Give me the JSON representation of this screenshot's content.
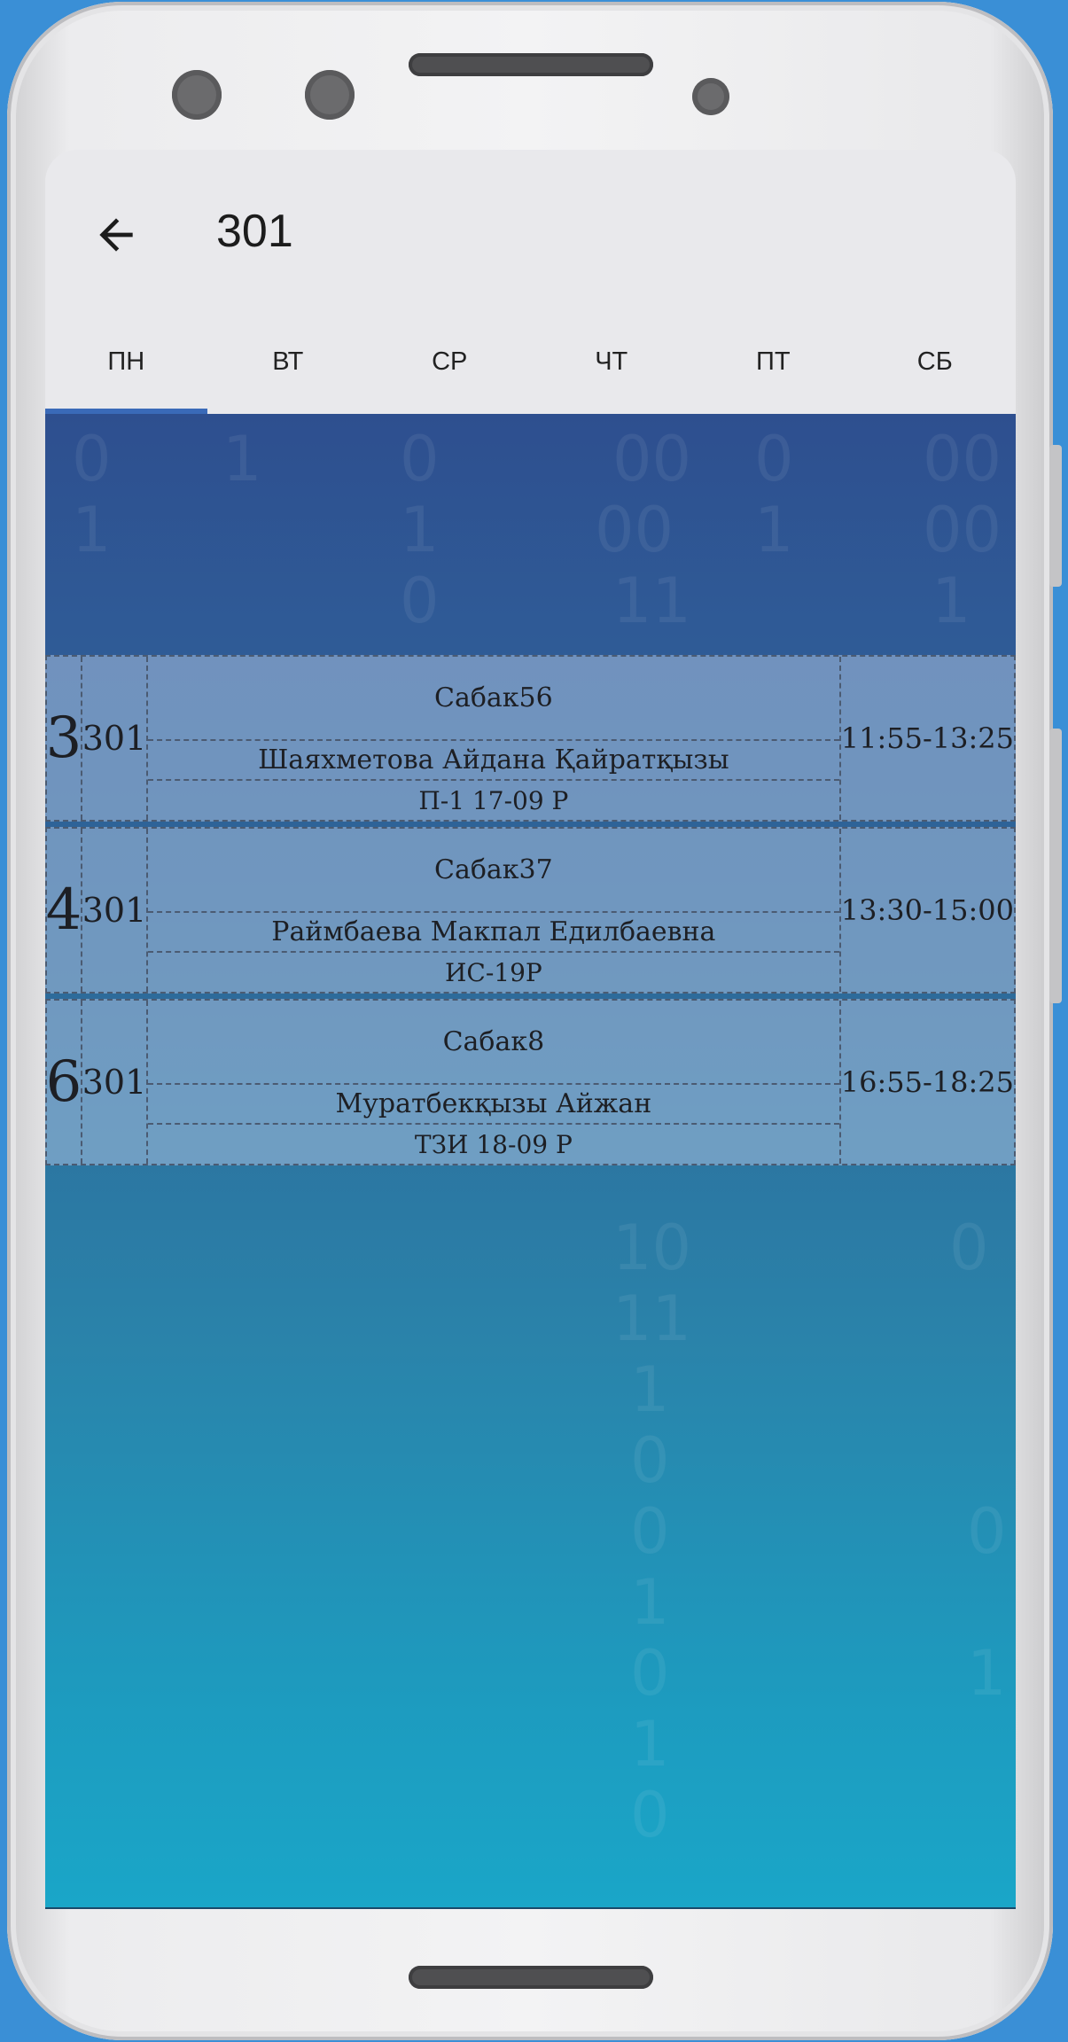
{
  "appbar": {
    "title": "301"
  },
  "tabs": [
    {
      "label": "ПН",
      "selected": true
    },
    {
      "label": "ВТ",
      "selected": false
    },
    {
      "label": "СР",
      "selected": false
    },
    {
      "label": "ЧТ",
      "selected": false
    },
    {
      "label": "ПТ",
      "selected": false
    },
    {
      "label": "СБ",
      "selected": false
    }
  ],
  "schedule": [
    {
      "num": "3",
      "room": "301",
      "subject": "Сабак56",
      "teacher": "Шаяхметова Айдана Қайратқызы",
      "group": "П-1 17-09 Р",
      "time": "11:55-13:25"
    },
    {
      "num": "4",
      "room": "301",
      "subject": "Сабак37",
      "teacher": "Раймбаева Макпал Едилбаевна",
      "group": "ИС-19Р",
      "time": "13:30-15:00"
    },
    {
      "num": "6",
      "room": "301",
      "subject": "Сабак8",
      "teacher": "Муратбекқызы Айжан",
      "group": "ТЗИ 18-09 Р",
      "time": "16:55-18:25"
    }
  ],
  "colors": {
    "accent": "#3a6ab8",
    "background": "#3a8fd6"
  }
}
